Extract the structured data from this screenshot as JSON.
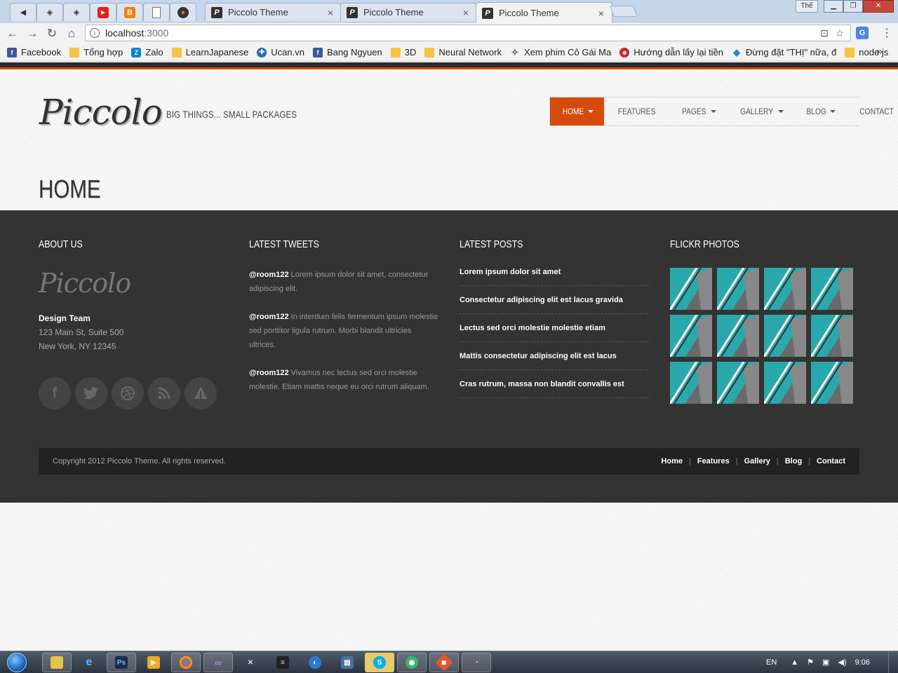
{
  "browser": {
    "tabs": [
      {
        "title": "Piccolo Theme",
        "active": false
      },
      {
        "title": "Piccolo Theme",
        "active": false
      },
      {
        "title": "Piccolo Theme",
        "active": true
      }
    ],
    "profile_label": "Thế",
    "url_host": "localhost",
    "url_port": ":3000",
    "bookmarks": [
      {
        "label": "Facebook",
        "icon": "facebook-icon"
      },
      {
        "label": "Tổng hợp",
        "icon": "folder-icon"
      },
      {
        "label": "Zalo",
        "icon": "zalo-icon"
      },
      {
        "label": "LearnJapanese",
        "icon": "folder-icon"
      },
      {
        "label": "Ucan.vn",
        "icon": "ucan-icon"
      },
      {
        "label": "Bang Ngyuen",
        "icon": "facebook-icon"
      },
      {
        "label": "3D",
        "icon": "folder-icon"
      },
      {
        "label": "Neural Network",
        "icon": "folder-icon"
      },
      {
        "label": "Xem phim Cô Gái Ma",
        "icon": "diamond-icon"
      },
      {
        "label": "Hướng dẫn lấy lại tiền",
        "icon": "smiley-icon"
      },
      {
        "label": "Đừng đặt \"THỊ\" nữa, đ",
        "icon": "drop-icon"
      },
      {
        "label": "node js",
        "icon": "folder-icon"
      }
    ]
  },
  "site": {
    "logo": "Piccolo",
    "tagline": "BIG THINGS... SMALL PACKAGES",
    "nav": [
      {
        "label": "HOME",
        "dropdown": true,
        "active": true
      },
      {
        "label": "FEATURES",
        "dropdown": false,
        "active": false
      },
      {
        "label": "PAGES",
        "dropdown": true,
        "active": false
      },
      {
        "label": "GALLERY",
        "dropdown": true,
        "active": false
      },
      {
        "label": "BLOG",
        "dropdown": true,
        "active": false
      },
      {
        "label": "CONTACT",
        "dropdown": false,
        "active": false
      }
    ],
    "page_title": "HOME",
    "accent_color": "#d54b0d"
  },
  "footer": {
    "about": {
      "heading": "ABOUT US",
      "logo": "Piccolo",
      "team": "Design Team",
      "address1": "123 Main St, Suite 500",
      "address2": "New York, NY 12345",
      "socials": [
        "facebook-icon",
        "twitter-icon",
        "dribbble-icon",
        "rss-icon",
        "forrst-icon"
      ]
    },
    "tweets": {
      "heading": "LATEST TWEETS",
      "items": [
        {
          "handle": "@room122",
          "text": " Lorem ipsum dolor sit amet, consectetur adipiscing elit."
        },
        {
          "handle": "@room122",
          "text": " In interdum felis fermentum ipsum molestie sed porttitor ligula rutrum. Morbi blandit ultricies ultrices."
        },
        {
          "handle": "@room122",
          "text": " Vivamus nec lectus sed orci molestie molestie. Etiam mattis neque eu orci rutrum aliquam."
        }
      ]
    },
    "posts": {
      "heading": "LATEST POSTS",
      "items": [
        "Lorem ipsum dolor sit amet",
        "Consectetur adipiscing elit est lacus gravida",
        "Lectus sed orci molestie molestie etiam",
        "Mattis consectetur adipiscing elit est lacus",
        "Cras rutrum, massa non blandit convallis est"
      ]
    },
    "flickr": {
      "heading": "FLICKR PHOTOS",
      "count": 12
    },
    "copyright": "Copyright 2012 Piccolo Theme. All rights reserved.",
    "links": [
      "Home",
      "Features",
      "Gallery",
      "Blog",
      "Contact"
    ]
  },
  "taskbar": {
    "lang": "EN",
    "clock": "9:06"
  }
}
